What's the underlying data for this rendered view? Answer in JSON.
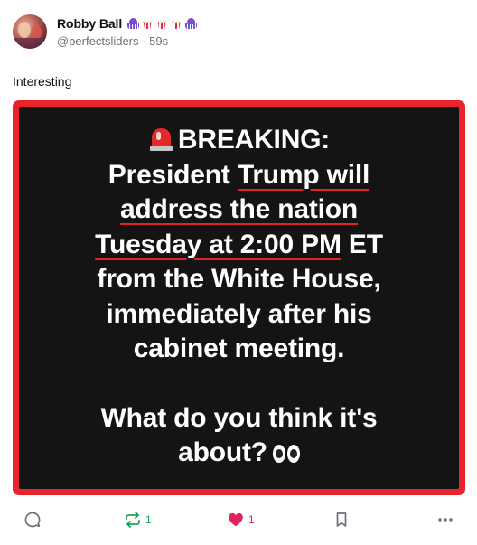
{
  "author": {
    "display_name": "Robby Ball",
    "name_emojis": [
      "octopus-icon",
      "popcorn-icon",
      "popcorn-icon",
      "popcorn-icon",
      "octopus-icon"
    ],
    "handle": "@perfectsliders",
    "separator": "·",
    "timestamp": "59s"
  },
  "post": {
    "text": "Interesting"
  },
  "media": {
    "lines": {
      "l1": "BREAKING:",
      "l2a": "President ",
      "l2b": "Trump will",
      "l3": "address the nation",
      "l4a": "Tuesday at 2:00 PM",
      "l4b": " ET",
      "l5": "from the White House,",
      "l6": "immediately after his",
      "l7": "cabinet meeting.",
      "l8": "What do you think it's",
      "l9": "about?"
    },
    "emoji_icons": [
      "siren-icon",
      "eyes-icon"
    ],
    "frame_color": "#e8232b",
    "background_color": "#151414",
    "underline_color": "#e0232b"
  },
  "actions": {
    "reply_count": "",
    "repost_count": "1",
    "like_count": "1",
    "repost_color": "#1aa35a",
    "like_color": "#e0245e"
  }
}
